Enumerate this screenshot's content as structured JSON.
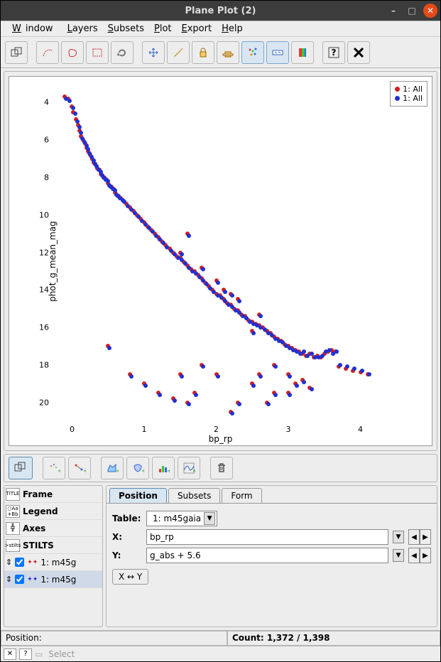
{
  "window": {
    "title": "Plane Plot (2)"
  },
  "menu": {
    "window": "Window",
    "layers": "Layers",
    "subsets": "Subsets",
    "plot": "Plot",
    "export": "Export",
    "help": "Help"
  },
  "legend": {
    "items": [
      {
        "label": "1: All",
        "color": "#d02020"
      },
      {
        "label": "1: All",
        "color": "#2030d0"
      }
    ]
  },
  "axes": {
    "x_label": "bp_rp",
    "y_label": "phot_g_mean_mag",
    "x_ticks": [
      "0",
      "1",
      "2",
      "3",
      "4"
    ],
    "y_ticks": [
      "4",
      "6",
      "8",
      "10",
      "12",
      "14",
      "16",
      "18",
      "20"
    ]
  },
  "layer_panel": {
    "items": [
      {
        "label": "Frame"
      },
      {
        "label": "Legend"
      },
      {
        "label": "Axes"
      },
      {
        "label": "STILTS"
      },
      {
        "label": "1: m45g",
        "checked": true,
        "selected": false
      },
      {
        "label": "1: m45g",
        "checked": true,
        "selected": true
      }
    ]
  },
  "tabs": {
    "position": "Position",
    "subsets": "Subsets",
    "form": "Form"
  },
  "form": {
    "table_label": "Table:",
    "table_value": "1: m45gaia",
    "x_label": "X:",
    "x_value": "bp_rp",
    "y_label": "Y:",
    "y_value": "g_abs + 5.6",
    "swap": "X ↔ Y"
  },
  "status": {
    "position_label": "Position:",
    "count": "Count: 1,372 / 1,398"
  },
  "footer": {
    "select": "Select"
  },
  "chart_data": {
    "type": "scatter",
    "title": "",
    "xlabel": "bp_rp",
    "ylabel": "phot_g_mean_mag",
    "xlim": [
      -0.3,
      4.3
    ],
    "ylim": [
      21,
      3
    ],
    "series": [
      {
        "name": "1: All",
        "color": "#d02020",
        "points": [
          [
            -0.1,
            3.7
          ],
          [
            -0.05,
            3.8
          ],
          [
            0,
            4.2
          ],
          [
            0.02,
            4.5
          ],
          [
            0.05,
            4.9
          ],
          [
            0.08,
            5.2
          ],
          [
            0.1,
            5.5
          ],
          [
            0.12,
            5.8
          ],
          [
            0.15,
            6.0
          ],
          [
            0.18,
            6.2
          ],
          [
            0.2,
            6.4
          ],
          [
            0.22,
            6.6
          ],
          [
            0.25,
            6.8
          ],
          [
            0.28,
            7.0
          ],
          [
            0.3,
            7.2
          ],
          [
            0.32,
            7.3
          ],
          [
            0.35,
            7.5
          ],
          [
            0.38,
            7.6
          ],
          [
            0.4,
            7.8
          ],
          [
            0.42,
            7.9
          ],
          [
            0.45,
            8.0
          ],
          [
            0.48,
            8.1
          ],
          [
            0.5,
            8.3
          ],
          [
            0.52,
            8.4
          ],
          [
            0.55,
            8.5
          ],
          [
            0.58,
            8.6
          ],
          [
            0.6,
            8.8
          ],
          [
            0.62,
            8.9
          ],
          [
            0.65,
            9.0
          ],
          [
            0.68,
            9.1
          ],
          [
            0.7,
            9.2
          ],
          [
            0.75,
            9.4
          ],
          [
            0.8,
            9.6
          ],
          [
            0.85,
            9.8
          ],
          [
            0.9,
            10.0
          ],
          [
            0.95,
            10.2
          ],
          [
            1.0,
            10.4
          ],
          [
            1.05,
            10.6
          ],
          [
            1.1,
            10.8
          ],
          [
            1.15,
            11.0
          ],
          [
            1.2,
            11.2
          ],
          [
            1.25,
            11.4
          ],
          [
            1.3,
            11.6
          ],
          [
            1.35,
            11.8
          ],
          [
            1.4,
            12.0
          ],
          [
            1.45,
            12.2
          ],
          [
            1.5,
            12.3
          ],
          [
            1.55,
            12.5
          ],
          [
            1.6,
            12.7
          ],
          [
            1.65,
            12.9
          ],
          [
            1.7,
            13.0
          ],
          [
            1.75,
            13.2
          ],
          [
            1.8,
            13.4
          ],
          [
            1.85,
            13.6
          ],
          [
            1.9,
            13.8
          ],
          [
            1.95,
            14.0
          ],
          [
            2.0,
            14.2
          ],
          [
            2.05,
            14.3
          ],
          [
            2.1,
            14.5
          ],
          [
            2.15,
            14.7
          ],
          [
            2.2,
            14.8
          ],
          [
            2.25,
            15.0
          ],
          [
            2.3,
            15.1
          ],
          [
            2.35,
            15.3
          ],
          [
            2.4,
            15.4
          ],
          [
            2.45,
            15.6
          ],
          [
            2.5,
            15.7
          ],
          [
            2.55,
            15.8
          ],
          [
            2.6,
            15.9
          ],
          [
            2.65,
            16.0
          ],
          [
            2.7,
            16.2
          ],
          [
            2.75,
            16.3
          ],
          [
            2.8,
            16.5
          ],
          [
            2.85,
            16.6
          ],
          [
            2.9,
            16.7
          ],
          [
            2.95,
            16.9
          ],
          [
            3.0,
            17.0
          ],
          [
            3.05,
            17.1
          ],
          [
            3.1,
            17.2
          ],
          [
            3.15,
            17.3
          ],
          [
            3.2,
            17.4
          ],
          [
            3.25,
            17.5
          ],
          [
            3.3,
            17.4
          ],
          [
            3.35,
            17.6
          ],
          [
            3.4,
            17.5
          ],
          [
            3.45,
            17.6
          ],
          [
            3.5,
            17.4
          ],
          [
            3.55,
            17.3
          ],
          [
            3.6,
            17.2
          ],
          [
            3.65,
            17.3
          ],
          [
            3.7,
            18.1
          ],
          [
            3.8,
            18.2
          ],
          [
            3.9,
            18.3
          ],
          [
            4.0,
            18.4
          ],
          [
            4.1,
            18.5
          ],
          [
            1.5,
            12.0
          ],
          [
            1.6,
            11.0
          ],
          [
            1.8,
            12.8
          ],
          [
            2.0,
            13.5
          ],
          [
            2.1,
            14.0
          ],
          [
            2.2,
            14.2
          ],
          [
            2.3,
            14.5
          ],
          [
            2.5,
            16.2
          ],
          [
            2.6,
            15.3
          ],
          [
            0.5,
            17.0
          ],
          [
            0.8,
            18.5
          ],
          [
            1.0,
            19.0
          ],
          [
            1.2,
            19.5
          ],
          [
            1.4,
            19.8
          ],
          [
            1.5,
            18.5
          ],
          [
            1.6,
            20.0
          ],
          [
            1.7,
            19.5
          ],
          [
            1.8,
            18.0
          ],
          [
            2.0,
            18.5
          ],
          [
            2.2,
            20.5
          ],
          [
            2.3,
            20.0
          ],
          [
            2.5,
            19.0
          ],
          [
            2.6,
            18.5
          ],
          [
            2.8,
            18.0
          ],
          [
            3.0,
            19.5
          ],
          [
            3.0,
            18.5
          ],
          [
            3.1,
            19.0
          ],
          [
            3.2,
            18.8
          ],
          [
            3.3,
            19.2
          ],
          [
            2.7,
            20.0
          ],
          [
            2.8,
            19.5
          ]
        ]
      },
      {
        "name": "1: All",
        "color": "#2030d0",
        "points": [
          [
            -0.08,
            3.8
          ],
          [
            -0.03,
            3.9
          ],
          [
            0.02,
            4.3
          ],
          [
            0.04,
            4.6
          ],
          [
            0.07,
            5.0
          ],
          [
            0.1,
            5.3
          ],
          [
            0.12,
            5.6
          ],
          [
            0.14,
            5.9
          ],
          [
            0.17,
            6.1
          ],
          [
            0.2,
            6.3
          ],
          [
            0.22,
            6.5
          ],
          [
            0.24,
            6.7
          ],
          [
            0.27,
            6.9
          ],
          [
            0.3,
            7.1
          ],
          [
            0.32,
            7.3
          ],
          [
            0.34,
            7.4
          ],
          [
            0.37,
            7.6
          ],
          [
            0.4,
            7.7
          ],
          [
            0.42,
            7.9
          ],
          [
            0.44,
            8.0
          ],
          [
            0.47,
            8.1
          ],
          [
            0.5,
            8.2
          ],
          [
            0.52,
            8.4
          ],
          [
            0.54,
            8.5
          ],
          [
            0.57,
            8.6
          ],
          [
            0.6,
            8.7
          ],
          [
            0.62,
            8.9
          ],
          [
            0.64,
            9.0
          ],
          [
            0.67,
            9.1
          ],
          [
            0.7,
            9.2
          ],
          [
            0.72,
            9.3
          ],
          [
            0.77,
            9.5
          ],
          [
            0.82,
            9.7
          ],
          [
            0.87,
            9.9
          ],
          [
            0.92,
            10.1
          ],
          [
            0.97,
            10.3
          ],
          [
            1.02,
            10.5
          ],
          [
            1.07,
            10.7
          ],
          [
            1.12,
            10.9
          ],
          [
            1.17,
            11.1
          ],
          [
            1.22,
            11.3
          ],
          [
            1.27,
            11.5
          ],
          [
            1.32,
            11.7
          ],
          [
            1.37,
            11.9
          ],
          [
            1.42,
            12.1
          ],
          [
            1.47,
            12.3
          ],
          [
            1.52,
            12.4
          ],
          [
            1.57,
            12.6
          ],
          [
            1.62,
            12.8
          ],
          [
            1.67,
            13.0
          ],
          [
            1.72,
            13.1
          ],
          [
            1.77,
            13.3
          ],
          [
            1.82,
            13.5
          ],
          [
            1.87,
            13.7
          ],
          [
            1.92,
            13.9
          ],
          [
            1.97,
            14.1
          ],
          [
            2.02,
            14.3
          ],
          [
            2.07,
            14.4
          ],
          [
            2.12,
            14.6
          ],
          [
            2.17,
            14.8
          ],
          [
            2.22,
            14.9
          ],
          [
            2.27,
            15.1
          ],
          [
            2.32,
            15.2
          ],
          [
            2.37,
            15.4
          ],
          [
            2.42,
            15.5
          ],
          [
            2.47,
            15.7
          ],
          [
            2.52,
            15.8
          ],
          [
            2.57,
            15.9
          ],
          [
            2.62,
            16.0
          ],
          [
            2.67,
            16.1
          ],
          [
            2.72,
            16.3
          ],
          [
            2.77,
            16.4
          ],
          [
            2.82,
            16.6
          ],
          [
            2.87,
            16.7
          ],
          [
            2.92,
            16.8
          ],
          [
            2.97,
            17.0
          ],
          [
            3.02,
            17.1
          ],
          [
            3.07,
            17.2
          ],
          [
            3.12,
            17.3
          ],
          [
            3.17,
            17.4
          ],
          [
            3.22,
            17.3
          ],
          [
            3.27,
            17.5
          ],
          [
            3.32,
            17.4
          ],
          [
            3.37,
            17.6
          ],
          [
            3.42,
            17.6
          ],
          [
            3.47,
            17.5
          ],
          [
            3.52,
            17.3
          ],
          [
            3.57,
            17.2
          ],
          [
            3.62,
            17.4
          ],
          [
            3.67,
            17.3
          ],
          [
            3.72,
            18.0
          ],
          [
            3.82,
            18.1
          ],
          [
            3.92,
            18.2
          ],
          [
            4.02,
            18.3
          ],
          [
            4.12,
            18.5
          ],
          [
            1.52,
            12.1
          ],
          [
            1.62,
            11.1
          ],
          [
            1.82,
            12.9
          ],
          [
            2.02,
            13.6
          ],
          [
            2.12,
            14.1
          ],
          [
            2.22,
            14.3
          ],
          [
            2.32,
            14.6
          ],
          [
            2.52,
            16.3
          ],
          [
            2.62,
            15.4
          ],
          [
            0.52,
            17.1
          ],
          [
            0.82,
            18.6
          ],
          [
            1.02,
            19.1
          ],
          [
            1.22,
            19.6
          ],
          [
            1.42,
            19.9
          ],
          [
            1.52,
            18.6
          ],
          [
            1.62,
            20.1
          ],
          [
            1.72,
            19.6
          ],
          [
            1.82,
            18.1
          ],
          [
            2.02,
            18.6
          ],
          [
            2.22,
            20.6
          ],
          [
            2.32,
            20.1
          ],
          [
            2.52,
            19.1
          ],
          [
            2.62,
            18.6
          ],
          [
            2.82,
            18.1
          ],
          [
            3.02,
            19.6
          ],
          [
            3.02,
            18.6
          ],
          [
            3.12,
            19.1
          ],
          [
            3.22,
            18.9
          ],
          [
            3.32,
            19.3
          ],
          [
            2.72,
            20.1
          ],
          [
            2.82,
            19.6
          ]
        ]
      }
    ]
  }
}
